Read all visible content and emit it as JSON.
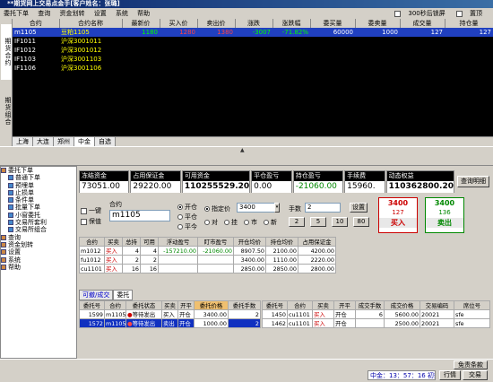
{
  "app": {
    "title": "**期货网上交易点金手[客户姓名：张璐]"
  },
  "menu": [
    "委托下单",
    "查询",
    "资金划转",
    "设置",
    "系统",
    "帮助"
  ],
  "menu_right": {
    "lock_label": "300秒后锁屏",
    "top_label": "置顶"
  },
  "left_tabs": [
    "期货合约",
    "期货组合"
  ],
  "quote": {
    "headers": [
      "合约",
      "合约名称",
      "最新价",
      "买入价",
      "卖出价",
      "涨跌",
      "涨跌幅",
      "委买量",
      "委卖量",
      "成交量",
      "持仓量"
    ],
    "rows": [
      {
        "code": "m1105",
        "name": "豆粕1105",
        "last": "1180",
        "bid": "1280",
        "ask": "1380",
        "chg": "-3007",
        "pct": "-71.82%",
        "bidvol": "60000",
        "askvol": "1000",
        "vol": "127",
        "oi": "127"
      },
      {
        "code": "IF1011",
        "name": "沪深3001011",
        "last": "",
        "bid": "",
        "ask": "",
        "chg": "",
        "pct": "",
        "bidvol": "",
        "askvol": "",
        "vol": "",
        "oi": ""
      },
      {
        "code": "IF1012",
        "name": "沪深3001012",
        "last": "",
        "bid": "",
        "ask": "",
        "chg": "",
        "pct": "",
        "bidvol": "",
        "askvol": "",
        "vol": "",
        "oi": ""
      },
      {
        "code": "IF1103",
        "name": "沪深3001103",
        "last": "",
        "bid": "",
        "ask": "",
        "chg": "",
        "pct": "",
        "bidvol": "",
        "askvol": "",
        "vol": "",
        "oi": ""
      },
      {
        "code": "IF1106",
        "name": "沪深3001106",
        "last": "",
        "bid": "",
        "ask": "",
        "chg": "",
        "pct": "",
        "bidvol": "",
        "askvol": "",
        "vol": "",
        "oi": ""
      }
    ]
  },
  "exchange_tabs": [
    "上海",
    "大连",
    "郑州",
    "中金",
    "自选"
  ],
  "tree": [
    "委托下单",
    "普通下单",
    "预埋单",
    "止损单",
    "条件单",
    "批量下单",
    "小窗委托",
    "交易所套利",
    "交易所组合",
    "查询",
    "资金划转",
    "设置",
    "系统",
    "帮助"
  ],
  "account": {
    "labels": [
      "冻结资金",
      "占用保证金",
      "可用资金",
      "平仓盈亏",
      "持仓盈亏",
      "手续费",
      "动态权益"
    ],
    "values": [
      "73051.00",
      "29220.00",
      "110255529.20",
      "0.00",
      "-21060.00",
      "15960.",
      "110362800.20"
    ],
    "detail_button": "查询明细"
  },
  "order": {
    "yijian": "一键",
    "baozhi": "保值",
    "contract_label": "合约",
    "contract_value": "m1105",
    "open": "开仓",
    "close": "平仓",
    "close_today": "平今",
    "price_type": "指定价",
    "price_value": "3400",
    "sub_options": [
      "对",
      "挂",
      "市",
      "新"
    ],
    "lots_label": "手数",
    "lots_value": "2",
    "set_button": "设置",
    "quick_lots": [
      "2",
      "5",
      "10",
      "80"
    ],
    "buy_price": "3400",
    "buy_qty": "127",
    "buy_label": "买入",
    "sell_price": "3400",
    "sell_qty": "136",
    "sell_label": "卖出"
  },
  "position": {
    "headers": [
      "合约",
      "买卖",
      "总持",
      "可用",
      "浮动盈亏",
      "盯市盈亏",
      "开仓均价",
      "持仓均价",
      "占用保证金"
    ],
    "rows": [
      [
        "m1012",
        "买入",
        "4",
        "4",
        "-157210.00",
        "-21060.00",
        "8907.50",
        "2100.00",
        "4200.00"
      ],
      [
        "fu1012",
        "买入",
        "2",
        "2",
        "",
        "",
        "3400.00",
        "1110.00",
        "2220.00"
      ],
      [
        "cu1101",
        "买入",
        "16",
        "16",
        "",
        "",
        "2850.00",
        "2850.00",
        "2800.00"
      ]
    ]
  },
  "lower_tabs": [
    "可撤/成交",
    "委托"
  ],
  "orders": {
    "headers": [
      "委托号",
      "合约",
      "委托状态",
      "买卖",
      "开平",
      "委托价格",
      "委托手数"
    ],
    "rows": [
      [
        "1599",
        "m1105",
        "等待发出",
        "买入",
        "开仓",
        "3400.00",
        "2"
      ],
      [
        "1572",
        "m1105",
        "等待发出",
        "卖出",
        "开仓",
        "1000.00",
        "2"
      ]
    ]
  },
  "trades": {
    "headers": [
      "委托号",
      "合约",
      "买卖",
      "开平",
      "成交手数",
      "成交价格",
      "交易编码",
      "席位号"
    ],
    "rows": [
      [
        "1450",
        "cu1101",
        "买入",
        "开仓",
        "6",
        "5600.00",
        "20021",
        "sfe"
      ],
      [
        "1462",
        "cu1101",
        "买入",
        "开仓",
        "",
        "2500.00",
        "20021",
        "sfe"
      ]
    ]
  },
  "status": {
    "exempt": "免责条款",
    "time": "中金：13：57：16 初始",
    "quote_btn": "行情",
    "trade_btn": "交易"
  }
}
